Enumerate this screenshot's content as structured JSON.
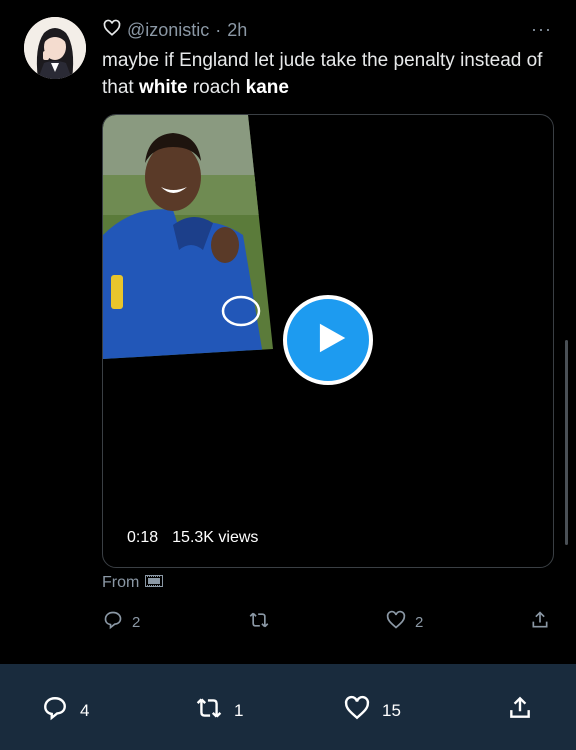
{
  "tweet": {
    "handle": "@izonistic",
    "separator": "·",
    "time": "2h",
    "more": "···",
    "text_parts": [
      {
        "t": "maybe if England let jude take the penalty instead of that ",
        "bold": false
      },
      {
        "t": "white",
        "bold": true
      },
      {
        "t": " roach ",
        "bold": false
      },
      {
        "t": "kane",
        "bold": true
      }
    ],
    "video": {
      "duration": "0:18",
      "views": "15.3K views"
    },
    "from_label": "From",
    "actions": {
      "replies": "2",
      "retweets": "",
      "likes": "2"
    }
  },
  "bottom_bar": {
    "replies": "4",
    "retweets": "1",
    "likes": "15"
  },
  "colors": {
    "accent": "#1d9bf0",
    "muted": "#8b98a5",
    "bar": "#192b3d"
  },
  "icons": [
    "heart-outline-icon",
    "more-icon",
    "play-icon",
    "film-icon",
    "reply-icon",
    "retweet-icon",
    "like-icon",
    "share-icon"
  ]
}
